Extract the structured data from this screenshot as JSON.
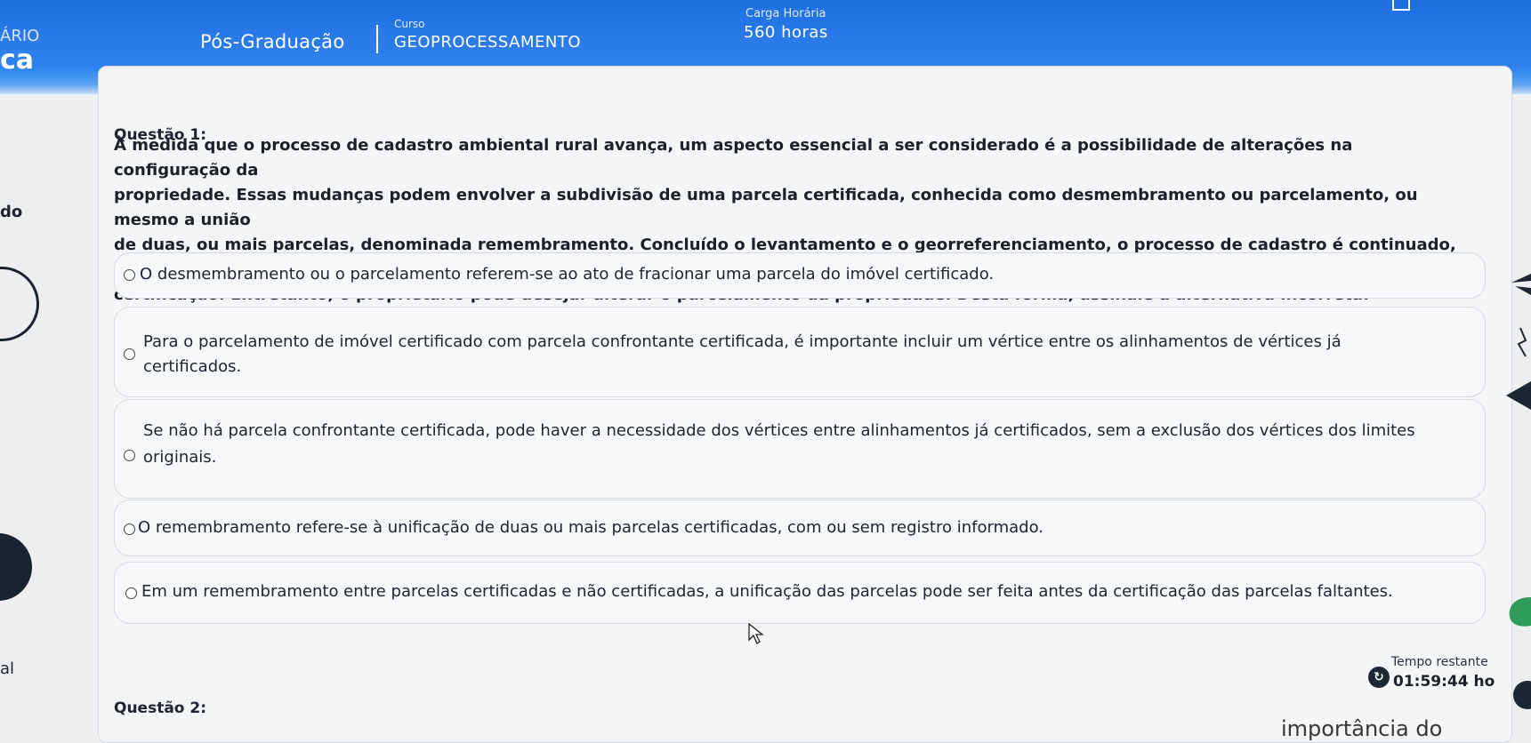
{
  "header": {
    "left_cut_1": "ÁRIO",
    "left_cut_2": "ca",
    "program": "Pós-Graduação",
    "course_label": "Curso",
    "course": "GEOPROCESSAMENTO",
    "hours_label": "Carga Horária",
    "hours": "560 horas"
  },
  "side": {
    "cut_do": "do",
    "cut_al": "al"
  },
  "question1": {
    "title": "Questão 1:",
    "stem_lines": [
      "À medida que o processo de cadastro ambiental rural avança, um aspecto essencial a ser considerado é a possibilidade de alterações na configuração da",
      "propriedade. Essas mudanças podem envolver a subdivisão de uma parcela certificada, conhecida como desmembramento ou parcelamento, ou mesmo a união",
      "de duas, ou mais parcelas, denominada remembramento. Concluído o levantamento e o georreferenciamento, o processo de cadastro é continuado, para obter a",
      "certificação. Entretanto, o proprietário pode desejar alterar o parcelamento da propriedade. Desta forma, assinale a alternativa incorreta:"
    ],
    "options": [
      {
        "line1": "O desmembramento ou o parcelamento referem-se ao ato de fracionar uma parcela do imóvel certificado.",
        "line2": ""
      },
      {
        "line1": "Para o parcelamento de imóvel certificado com parcela confrontante certificada, é importante incluir um vértice entre os alinhamentos de vértices já",
        "line2": "certificados."
      },
      {
        "line1": "Se não há parcela confrontante certificada, pode haver a necessidade dos vértices entre alinhamentos já certificados, sem a exclusão dos vértices dos limites",
        "line2": "originais."
      },
      {
        "line1": "O remembramento refere-se à unificação de duas ou mais parcelas certificadas, com ou sem registro informado.",
        "line2": ""
      },
      {
        "line1": "Em um remembramento entre parcelas certificadas e não certificadas, a unificação das parcelas pode ser feita antes da certificação das parcelas faltantes.",
        "line2": ""
      }
    ]
  },
  "timer": {
    "label": "Tempo restante",
    "value": "01:59:44 ho"
  },
  "question2": {
    "title": "Questão 2:"
  },
  "bottom": {
    "cut_text": "importância do"
  },
  "colors": {
    "header": "#2a7ae8",
    "text": "#1d2430"
  }
}
